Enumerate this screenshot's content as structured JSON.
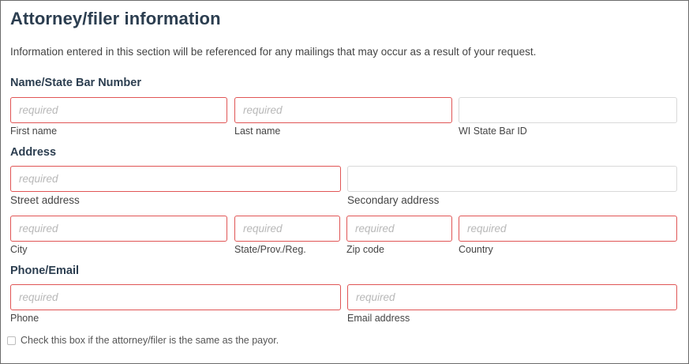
{
  "title": "Attorney/filer information",
  "intro": "Information entered in this section will be referenced for any mailings that may occur as a result of your request.",
  "sections": {
    "name": "Name/State Bar Number",
    "address": "Address",
    "phone_email": "Phone/Email"
  },
  "fields": {
    "first_name": {
      "placeholder": "required",
      "label": "First name"
    },
    "last_name": {
      "placeholder": "required",
      "label": "Last name"
    },
    "bar_id": {
      "placeholder": "",
      "label": "WI State Bar ID"
    },
    "street": {
      "placeholder": "required",
      "label": "Street address"
    },
    "secondary": {
      "placeholder": "",
      "label": "Secondary address"
    },
    "city": {
      "placeholder": "required",
      "label": "City"
    },
    "state": {
      "placeholder": "required",
      "label": "State/Prov./Reg."
    },
    "zip": {
      "placeholder": "required",
      "label": "Zip code"
    },
    "country": {
      "placeholder": "required",
      "label": "Country"
    },
    "phone": {
      "placeholder": "required",
      "label": "Phone"
    },
    "email": {
      "placeholder": "required",
      "label": "Email address"
    }
  },
  "checkbox": {
    "label": "Check this box if the attorney/filer is the same as the payor.",
    "checked": false
  },
  "colors": {
    "heading": "#2c3e50",
    "required_border": "#e05555",
    "normal_border": "#d9d9d9"
  }
}
